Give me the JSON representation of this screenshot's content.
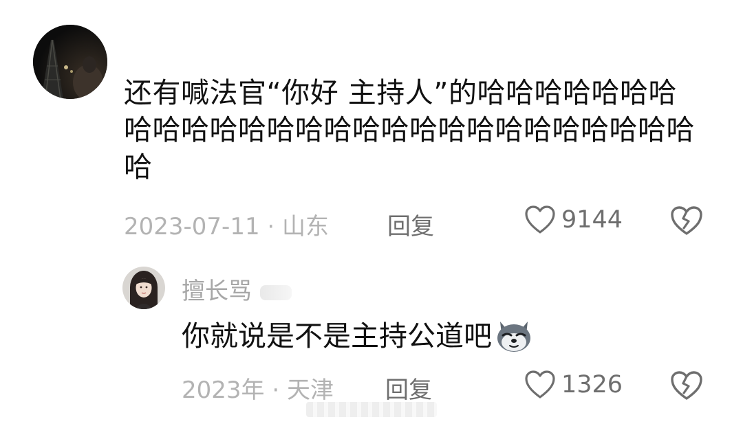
{
  "comments": [
    {
      "avatar_icon": "night-tower-avatar",
      "text": "还有喊法官“你好 主持人”的哈哈哈哈哈哈哈哈哈哈哈哈哈哈哈哈哈哈哈哈哈哈哈哈哈哈哈哈",
      "meta": "2023-07-11 · 山东",
      "reply_label": "回复",
      "like_icon": "heart-outline-icon",
      "likes": "9144",
      "dislike_icon": "broken-heart-icon"
    }
  ],
  "reply": {
    "avatar_icon": "woman-portrait-avatar",
    "username": "擅长骂",
    "text": "你就说是不是主持公道吧",
    "emoji_icon": "doge-wolf-emoji",
    "meta": "2023年 · 天津",
    "reply_label": "回复",
    "like_icon": "heart-outline-icon",
    "likes": "1326",
    "dislike_icon": "broken-heart-icon"
  },
  "colors": {
    "text_primary": "#111111",
    "text_meta": "#b3b3b3",
    "text_action": "#6e6e6e",
    "background": "#ffffff"
  }
}
